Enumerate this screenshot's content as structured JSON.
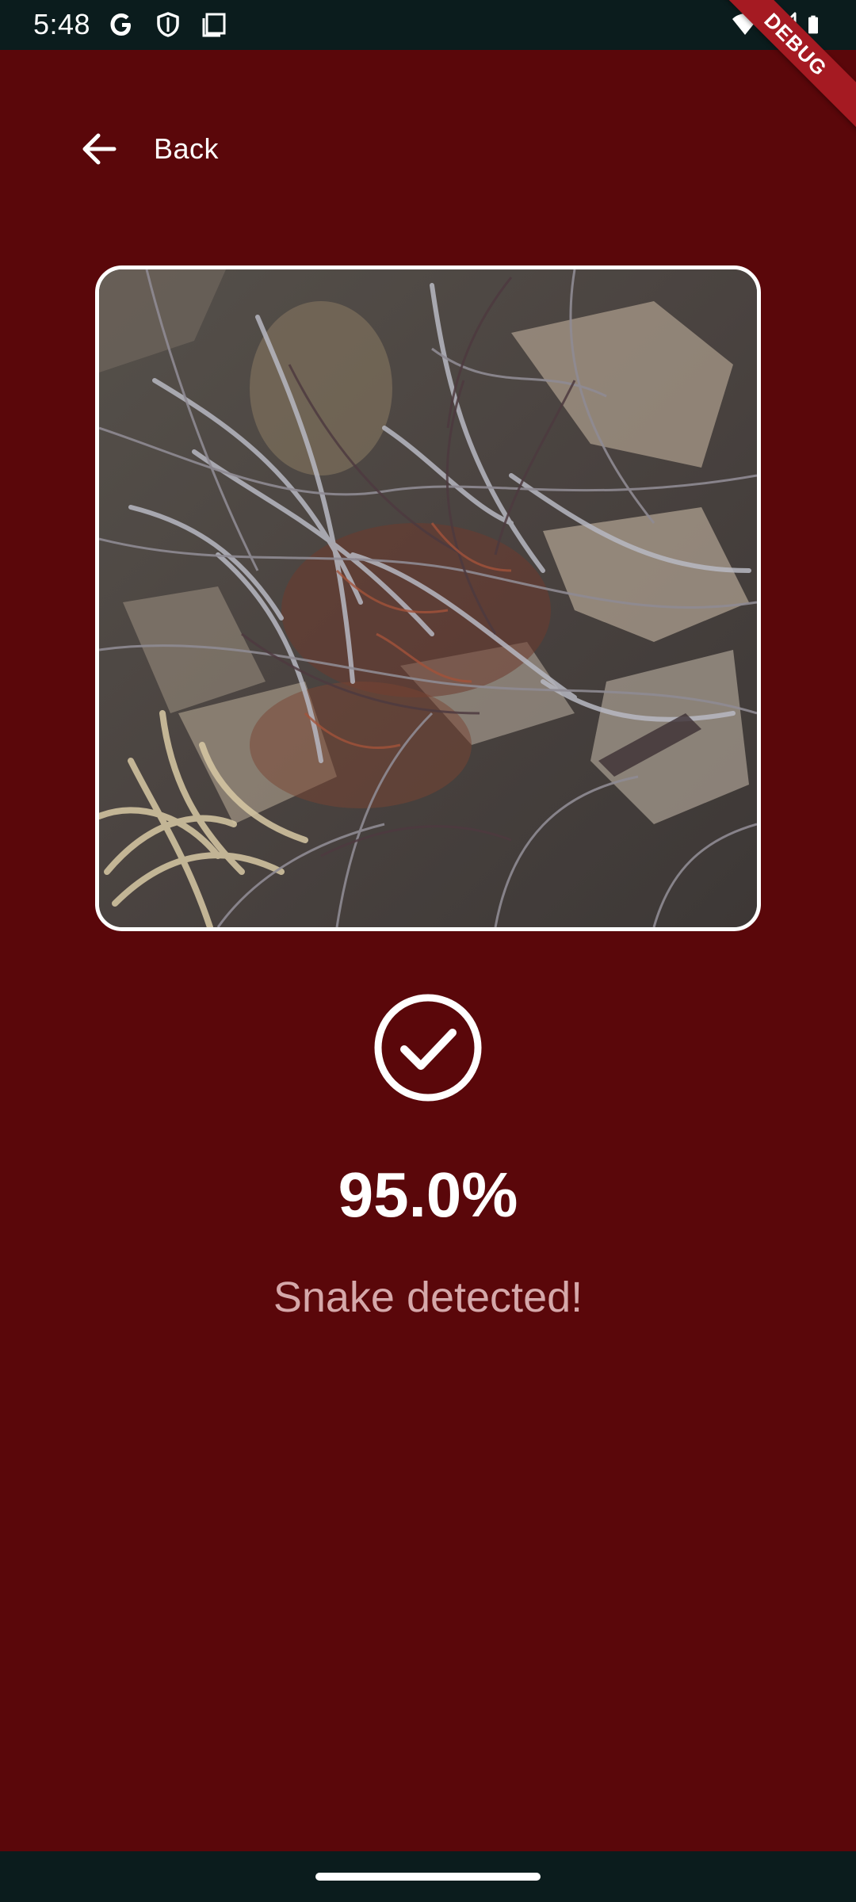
{
  "status_bar": {
    "time": "5:48",
    "left_icons": [
      "google-g-icon",
      "shield-icon",
      "screenshot-icon"
    ],
    "right_icons": [
      "wifi-icon",
      "signal-icon",
      "battery-icon"
    ]
  },
  "debug_banner": {
    "label": "DEBUG",
    "color": "#a51a22"
  },
  "header": {
    "back_icon": "arrow-left-icon",
    "back_label": "Back"
  },
  "result": {
    "status_icon": "check-circle-icon",
    "confidence": "95.0%",
    "message": "Snake detected!"
  },
  "theme": {
    "background": "#5a070a",
    "system_bar": "#0b1c1d",
    "text_primary": "#ffffff",
    "text_secondary": "#d5a8aa"
  }
}
